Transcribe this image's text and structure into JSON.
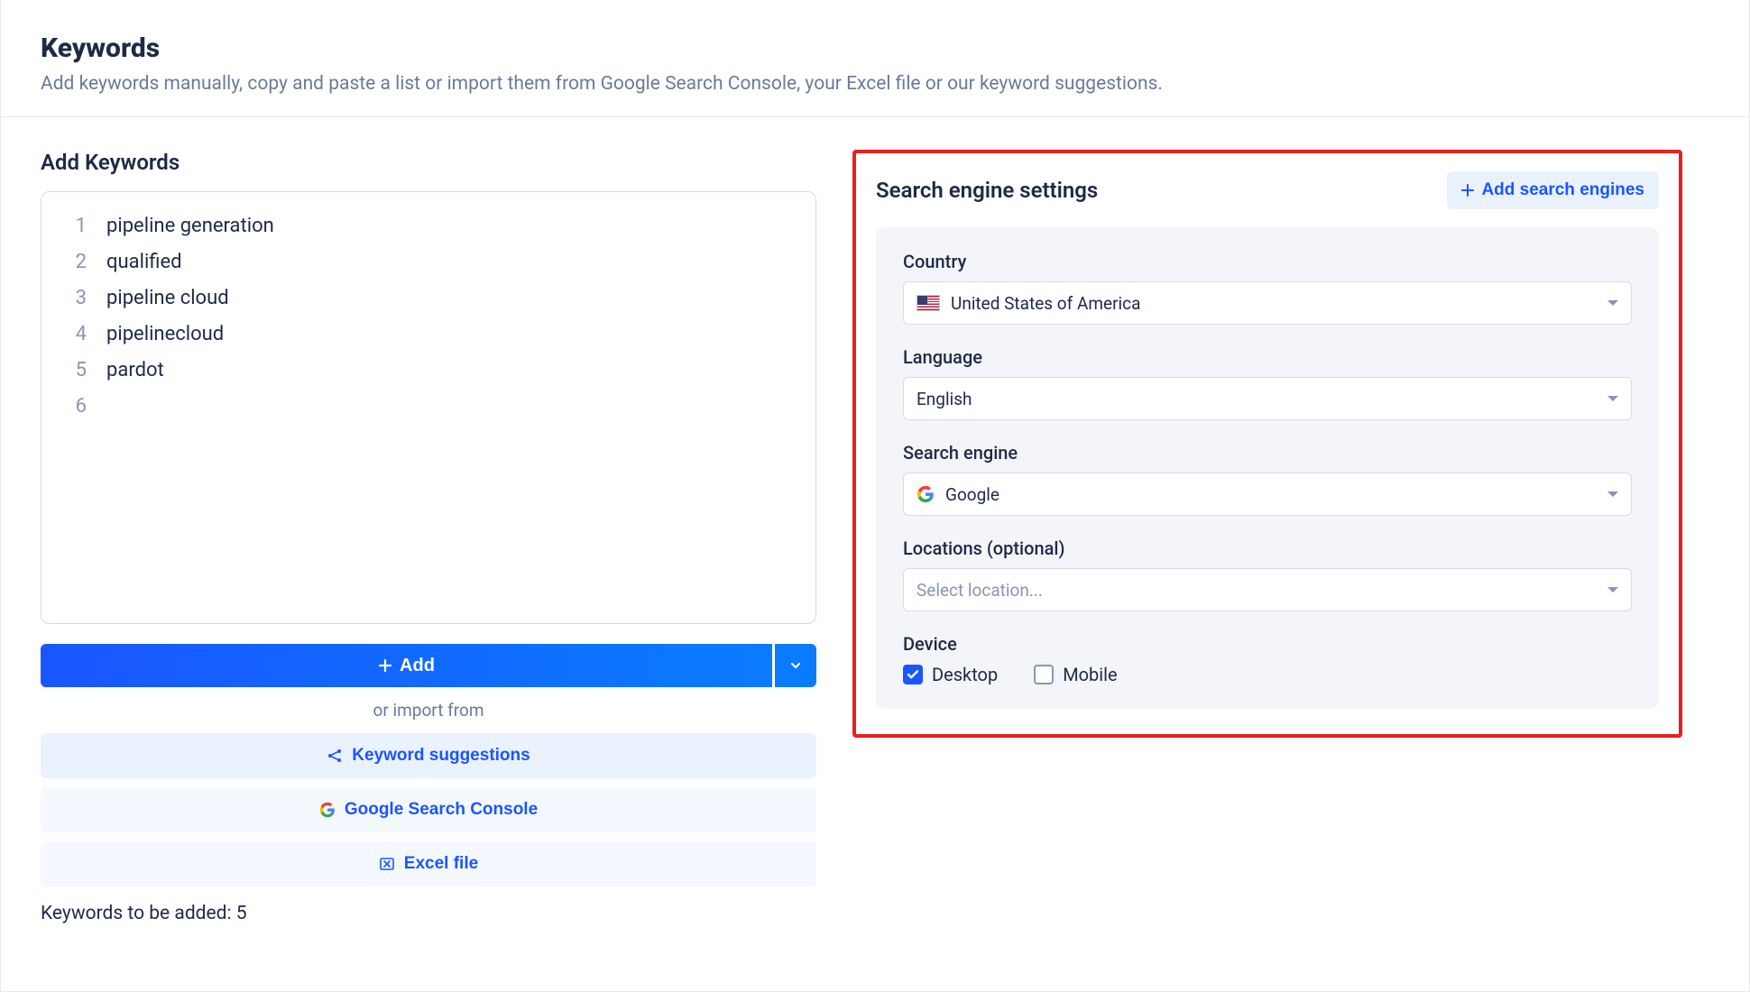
{
  "header": {
    "title": "Keywords",
    "subtitle": "Add keywords manually, copy and paste a list or import them from Google Search Console, your Excel file or our keyword suggestions."
  },
  "addKeywords": {
    "title": "Add Keywords",
    "lines": [
      {
        "n": "1",
        "text": "pipeline generation"
      },
      {
        "n": "2",
        "text": "qualified"
      },
      {
        "n": "3",
        "text": "pipeline cloud"
      },
      {
        "n": "4",
        "text": "pipelinecloud"
      },
      {
        "n": "5",
        "text": "pardot"
      },
      {
        "n": "6",
        "text": ""
      }
    ],
    "addButton": "Add",
    "importLabel": "or import from",
    "buttons": {
      "suggestions": "Keyword suggestions",
      "gsc": "Google Search Console",
      "excel": "Excel file"
    },
    "footer": "Keywords to be added: 5"
  },
  "searchEngineSettings": {
    "title": "Search engine settings",
    "addSearchEngines": "Add search engines",
    "country": {
      "label": "Country",
      "value": "United States of America"
    },
    "language": {
      "label": "Language",
      "value": "English"
    },
    "searchEngine": {
      "label": "Search engine",
      "value": "Google"
    },
    "locations": {
      "label": "Locations (optional)",
      "placeholder": "Select location..."
    },
    "device": {
      "label": "Device",
      "desktop": {
        "label": "Desktop",
        "checked": true
      },
      "mobile": {
        "label": "Mobile",
        "checked": false
      }
    }
  }
}
